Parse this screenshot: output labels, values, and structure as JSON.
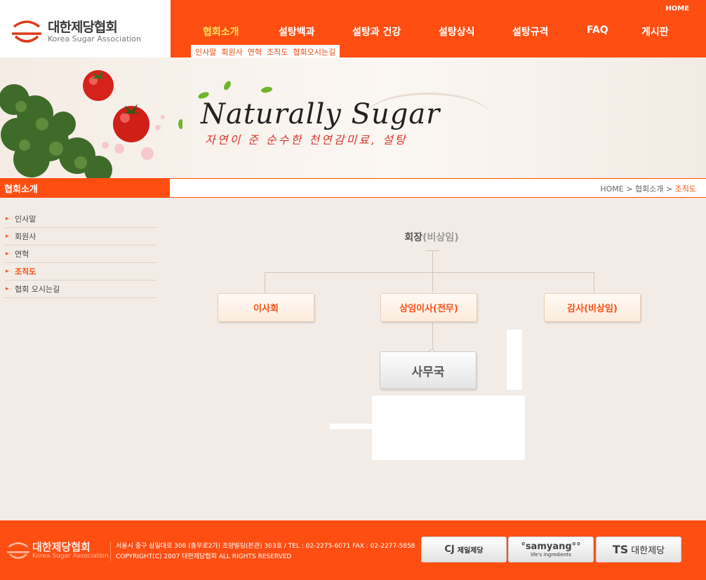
{
  "header": {
    "logo_ko": "대한제당협회",
    "logo_en": "Korea Sugar Association",
    "home_link": "HOME",
    "menu": [
      "협회소개",
      "설탕백과",
      "설탕과 건강",
      "설탕상식",
      "설탕규격",
      "FAQ",
      "게시판"
    ],
    "submenu": [
      "인사말",
      "회원사",
      "연혁",
      "조직도",
      "협회오시는길"
    ]
  },
  "banner": {
    "title": "Naturally Sugar",
    "subtitle": "자연이 준 순수한 천연감미료, 설탕"
  },
  "section": {
    "title": "협회소개",
    "breadcrumb_home": "HOME",
    "breadcrumb_section": "협회소개",
    "breadcrumb_current": "조직도"
  },
  "sidebar": {
    "items": [
      {
        "label": "인사말"
      },
      {
        "label": "회원사"
      },
      {
        "label": "연혁"
      },
      {
        "label": "조직도"
      },
      {
        "label": "협회 오시는길"
      }
    ]
  },
  "org_chart": {
    "top": "회장",
    "top_sub": "(비상임)",
    "board": "이사회",
    "executive": "상임이사(전무)",
    "auditor": "감사(비상임)",
    "office": "사무국"
  },
  "footer": {
    "logo_ko": "대한제당협회",
    "logo_en": "Korea Sugar Association",
    "address": "서울시 중구 삼일대로 308 (충무로2가) 조양빌딩(본관) 303호  /  TEL : 02-2275-6071   FAX : 02-2277-5858",
    "copyright": "COPYRIGHT(C) 2007  대한제당협회  ALL RIGHTS RESERVED",
    "partners": [
      {
        "logo": "CJ",
        "name": "제일제당"
      },
      {
        "logo": "°samyang°°",
        "name": "life's ingredients"
      },
      {
        "logo": "TS",
        "name": "대한제당"
      }
    ]
  },
  "colors": {
    "brand": "#ff4e12",
    "menu_active": "#ffe25a"
  }
}
